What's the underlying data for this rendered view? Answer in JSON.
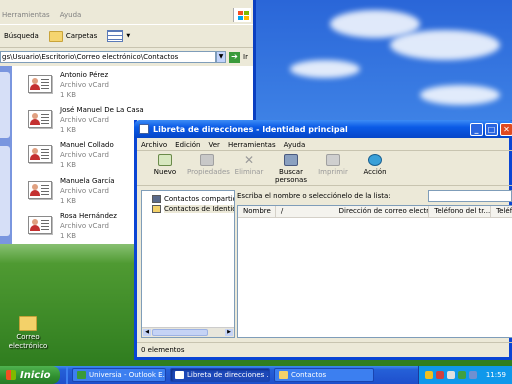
{
  "explorer": {
    "menu": [
      "Herramientas",
      "Ayuda"
    ],
    "toolbar": {
      "search_label": "Búsqueda",
      "folders_label": "Carpetas"
    },
    "address": "gs\\Usuario\\Escritorio\\Correo electrónico\\Contactos",
    "go_label": "Ir",
    "contacts": [
      {
        "name": "Antonio Pérez",
        "type": "Archivo vCard",
        "size": "1 KB"
      },
      {
        "name": "José Manuel De La Casa",
        "type": "Archivo vCard",
        "size": "1 KB"
      },
      {
        "name": "Manuel Collado",
        "type": "Archivo vCard",
        "size": "1 KB"
      },
      {
        "name": "Manuela García",
        "type": "Archivo vCard",
        "size": "1 KB"
      },
      {
        "name": "Rosa Hernández",
        "type": "Archivo vCard",
        "size": "1 KB"
      }
    ]
  },
  "desktop_icon": {
    "label": "Correo electrónico"
  },
  "address_book": {
    "title": "Libreta de direcciones - Identidad principal",
    "menu": [
      "Archivo",
      "Edición",
      "Ver",
      "Herramientas",
      "Ayuda"
    ],
    "toolbar": [
      {
        "label": "Nuevo",
        "icon": "new-contact-icon",
        "enabled": true
      },
      {
        "label": "Propiedades",
        "icon": "properties-icon",
        "enabled": false
      },
      {
        "label": "Eliminar",
        "icon": "delete-icon",
        "enabled": false
      },
      {
        "label": "Buscar personas",
        "icon": "find-people-icon",
        "enabled": true
      },
      {
        "label": "Imprimir",
        "icon": "print-icon",
        "enabled": false
      },
      {
        "label": "Acción",
        "icon": "action-icon",
        "enabled": true
      }
    ],
    "tree": [
      "Contactos compartidos",
      "Contactos de Identidad"
    ],
    "prompt": "Escriba el nombre o selecciónelo de la lista:",
    "search_value": "",
    "columns": [
      "Nombre",
      "/",
      "Dirección de correo electr...",
      "Teléfono del tr...",
      "Teléfo"
    ],
    "status": "0 elementos"
  },
  "taskbar": {
    "start_label": "Inicio",
    "tasks": [
      "Universia - Outlook E...",
      "Libreta de direcciones ...",
      "Contactos"
    ],
    "clock": "11:59"
  },
  "colors": {
    "title_blue": "#0a5ae6",
    "taskbar_blue": "#1e4fcc",
    "start_green": "#2f8f2f"
  }
}
